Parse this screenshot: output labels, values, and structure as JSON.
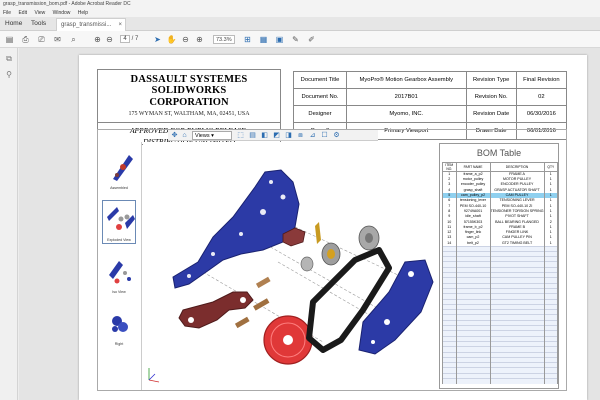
{
  "window": {
    "title": "grasp_transmission_bom.pdf - Adobe Acrobat Reader DC",
    "menu": [
      "File",
      "Edit",
      "View",
      "Window",
      "Help"
    ]
  },
  "tabs": {
    "home": "Home",
    "tools": "Tools",
    "document": "grasp_transmissi..."
  },
  "toolbar": {
    "page_current": "4",
    "page_total": "/ 7",
    "zoom": "73.3%"
  },
  "company": {
    "line1": "DASSAULT SYSTEMES SOLIDWORKS",
    "line2": "CORPORATION",
    "address": "175 WYMAN ST, WALTHAM, MA, 02451, USA",
    "release1": "APPROVED FOR PUBLIC RELEASE:",
    "release2": "DISTRIBUTION UNLIMITED"
  },
  "meta": {
    "rows": [
      [
        "Document Title",
        "MyoPro® Motion Gearbox Assembly",
        "Revision Type",
        "Final Revision"
      ],
      [
        "Document No.",
        "2017B01",
        "Revision No.",
        "02"
      ],
      [
        "Designer",
        "Myomo, INC.",
        "Revision Date",
        "06/30/2016"
      ],
      [
        "Page 3",
        "Primary Viewport",
        "Drawn Date",
        "06/01/2016"
      ]
    ]
  },
  "viewer": {
    "views_label": "Views",
    "thumbnails": [
      "Assembled",
      "Exploded View",
      "Iso View",
      "Right"
    ]
  },
  "bom": {
    "title": "BOM Table",
    "headers": [
      "ITEM NO.",
      "PART NAME",
      "DESCRIPTION",
      "QTY"
    ],
    "rows": [
      [
        "1",
        "frame_a_p2",
        "FRAME A",
        "1"
      ],
      [
        "2",
        "motor_pulley",
        "MOTOR PULLEY",
        "1"
      ],
      [
        "3",
        "encoder_pulley",
        "ENCODER PULLEY",
        "1"
      ],
      [
        "4",
        "grasp_shaft",
        "GRASP ACTUATOR SHAFT",
        "1"
      ],
      [
        "5",
        "cam_pulley_p2",
        "CAM PULLEY",
        "1"
      ],
      [
        "6",
        "tensioning_lever",
        "TENSIONING LEVER",
        "1"
      ],
      [
        "7",
        "PEM SO-440-10",
        "PEM SO-440-10 ZI",
        "1"
      ],
      [
        "8",
        "92749A001",
        "TENSIONER TORSION SPRING",
        "1"
      ],
      [
        "9",
        "idle_shaft",
        "PIVOT SHAFT",
        "1"
      ],
      [
        "10",
        "57155K303",
        "BALL BEARING FLANGED",
        "2"
      ],
      [
        "11",
        "frame_b_p2",
        "FRAME B",
        "1"
      ],
      [
        "12",
        "finger_link",
        "FINGER LINK",
        "1"
      ],
      [
        "13",
        "cam_p2",
        "CAM PULLEY PIN",
        "1"
      ],
      [
        "14",
        "belt_p2",
        "GT2 TIMING BELT",
        "1"
      ]
    ],
    "selected_index": 4
  }
}
